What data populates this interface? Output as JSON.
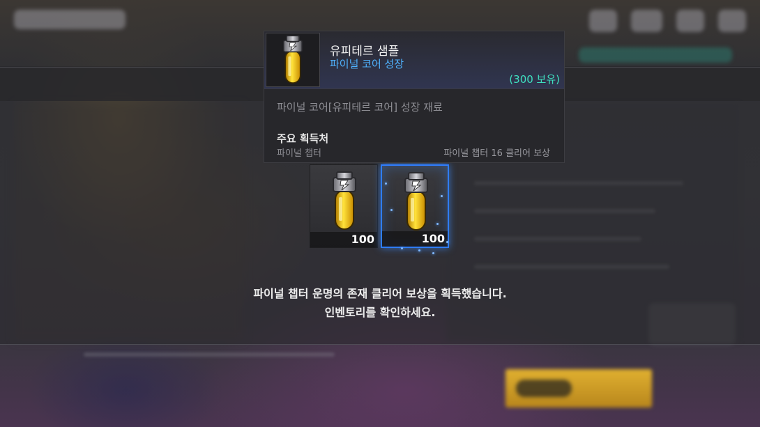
{
  "tooltip": {
    "item_name": "유피테르 샘플",
    "category": "파이널 코어 성장",
    "owned": "(300 보유)",
    "description": "파이널 코어[유피테르 코어] 성장 재료",
    "source_title": "주요 획득처",
    "source_name": "파이널 챕터",
    "source_detail": "파이널 챕터 16 클리어 보상",
    "icon": "yellow-vial-icon"
  },
  "rewards": [
    {
      "count": "100",
      "icon": "yellow-vial-icon"
    },
    {
      "count": "100",
      "icon": "yellow-vial-icon"
    }
  ],
  "message": {
    "line1": "파이널 챕터 운명의 존재 클리어 보상을 획득했습니다.",
    "line2": "인벤토리를 확인하세요."
  },
  "colors": {
    "category": "#4fb2ff",
    "owned": "#3fe0c0",
    "selected_border": "#2f7dff"
  }
}
